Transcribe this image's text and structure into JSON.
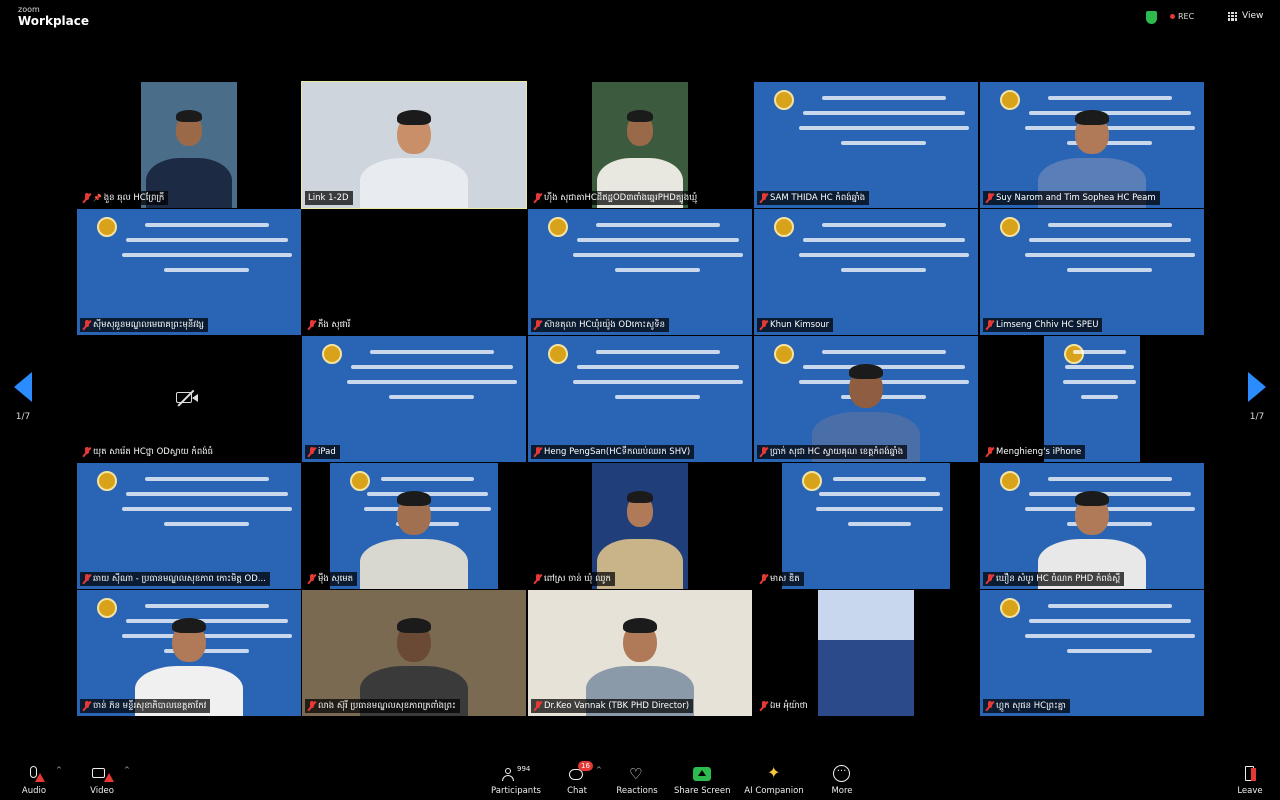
{
  "app": {
    "brand_sub": "zoom",
    "brand_main": "Workplace",
    "rec_label": "REC",
    "view_label": "View"
  },
  "pagination": {
    "left": "1/7",
    "right": "1/7"
  },
  "slide_title_lines": [
    "ការបណ្តុះបណ្តាលអំពី",
    "ភាពជាអ្នកដឹកនាំ និងជនាធុនថ្ជន់",
    "សម្រាប់ពង្រឹងអភិបាលកិច្ចសុខាភិបាល",
    "ឆ្នាំ ២០២៥"
  ],
  "participants": [
    {
      "name": "ងួន ឆុល HCព្រែក្រី",
      "muted": true,
      "pinned": true
    },
    {
      "name": "Link 1-2D",
      "muted": false,
      "pinned": false
    },
    {
      "name": "ហ៊ីង សុជាតាHCដីឥដ្ឋOD៣ពាំងឆ្នេរPHDត្បូងឃ្មុំ",
      "muted": true
    },
    {
      "name": "SAM THIDA HC កំពង់ឆ្នាំង",
      "muted": true
    },
    {
      "name": "Suy Narom and Tim Sophea HC Peam",
      "muted": true
    },
    {
      "name": "ស៊ីមសុឆួនមណ្ឌលមេរោគព្រះមុនីវង្ស",
      "muted": true
    },
    {
      "name": "ភឹង សុផារី",
      "muted": true
    },
    {
      "name": "ស៊ានតុលា HCឃុំរយ៉ូង ODកោះសូទិន",
      "muted": true
    },
    {
      "name": "Khun Kimsour",
      "muted": true
    },
    {
      "name": "Limseng Chhiv HC SPEU",
      "muted": true
    },
    {
      "name": "យុត សារ៉េត HCថ្នា ODស្វាយ កំពង់ធំ",
      "muted": true
    },
    {
      "name": "iPad",
      "muted": true
    },
    {
      "name": "Heng PengSan(HCទឹកឈប់ឈរក SHV)",
      "muted": true
    },
    {
      "name": "ប្រាក់ សុជា HC ស្វាយគុណ ខេត្តកំពង់ឆ្នាំង",
      "muted": true
    },
    {
      "name": "Menghieng's iPhone",
      "muted": true
    },
    {
      "name": "ឆាយ ស៊ីណា - ប្រធានមណ្ឌលសុខភាព កោះមិត្ត OD...",
      "muted": true
    },
    {
      "name": "ម៉ឺង សុមេត",
      "muted": true
    },
    {
      "name": "ពៅស្រ ចាន់ ឃុំ ឈូក",
      "muted": true
    },
    {
      "name": "មាស ឌិត",
      "muted": true
    },
    {
      "name": "ឃឿន សំបូរ HC ចំណក PHD កំពង់ស្ពឺ",
      "muted": true
    },
    {
      "name": "ចាន់ ភ៊ន មន្ទីរសុខាភិបាលខេត្តតាកែវ",
      "muted": true
    },
    {
      "name": "លាង ស៊ុរី ប្រធានមណ្ឌលសុខភាពត្រពាំងព្រះ",
      "muted": true
    },
    {
      "name": "Dr.Keo Vannak (TBK PHD Director)",
      "muted": true
    },
    {
      "name": "ឯម អុំយ៉ាថា",
      "muted": true
    },
    {
      "name": "ហ្គូក សុផន HCព្រះគ្នា",
      "muted": true
    }
  ],
  "toolbar": {
    "audio": "Audio",
    "video": "Video",
    "participants": "Participants",
    "participants_count": "994",
    "chat": "Chat",
    "chat_badge": "16",
    "reactions": "Reactions",
    "share": "Share Screen",
    "ai": "AI Companion",
    "more": "More",
    "leave": "Leave"
  },
  "colors": {
    "slide_blue": "#2a64b4",
    "accent": "#2a8cff",
    "share_green": "#2dbb4e",
    "alert_red": "#e53935"
  }
}
